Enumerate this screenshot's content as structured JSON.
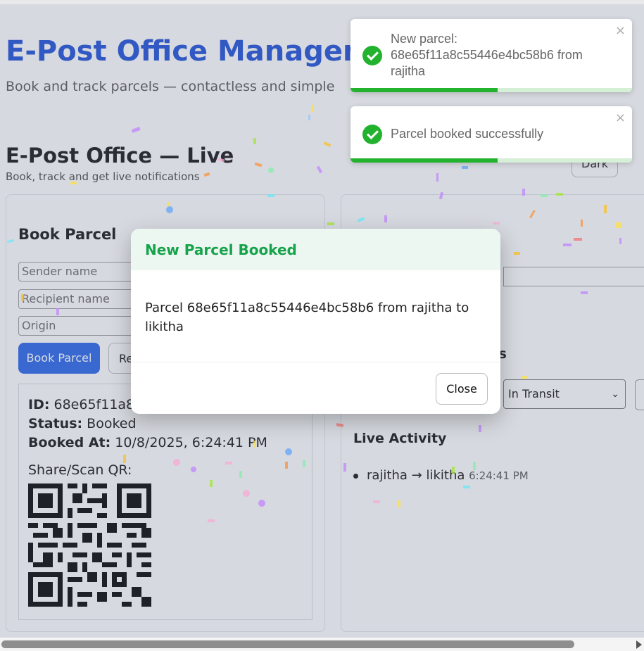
{
  "header": {
    "title": "E-Post Office Manageme",
    "subtitle": "Book and track parcels — contactless and simple"
  },
  "live": {
    "title": "E-Post Office — Live",
    "subtitle": "Book, track and get live notifications",
    "theme_button": "Dark"
  },
  "book": {
    "title": "Book Parcel",
    "sender_placeholder": "Sender name",
    "recipient_placeholder": "Recipient name",
    "origin_placeholder": "Origin",
    "book_button": "Book Parcel",
    "reset_button": "Re",
    "result": {
      "id_label": "ID:",
      "id_value": "68e65f11a8c5",
      "status_label": "Status:",
      "status_value": "Booked",
      "booked_label": "Booked At:",
      "booked_value": "10/8/2025, 6:24:41 PM",
      "qr_label": "Share/Scan QR:"
    }
  },
  "track": {
    "update_title_partial": "us",
    "status_selected": "In Transit"
  },
  "activity": {
    "title": "Live Activity",
    "items": [
      {
        "text": "rajitha → likitha",
        "time": "6:24:41 PM"
      }
    ]
  },
  "modal": {
    "title": "New Parcel Booked",
    "body": "Parcel 68e65f11a8c55446e4bc58b6 from rajitha to likitha",
    "close_button": "Close"
  },
  "toasts": [
    {
      "text": "New parcel: 68e65f11a8c55446e4bc58b6 from rajitha",
      "close": "×"
    },
    {
      "text": "Parcel booked successfully",
      "close": "×"
    }
  ],
  "colors": {
    "primary": "#2563eb",
    "title_blue": "#1d4ed8",
    "success": "#22b22e",
    "modal_title": "#16a34a"
  }
}
